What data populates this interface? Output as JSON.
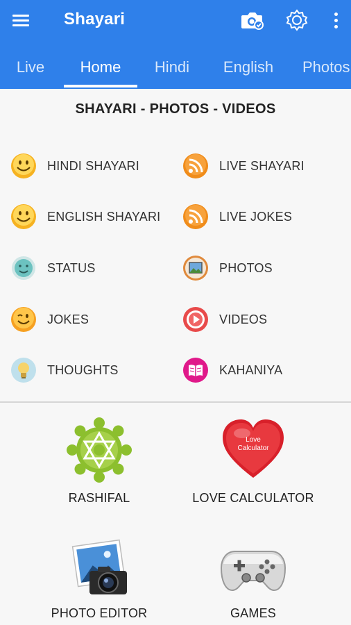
{
  "app": {
    "title": "Shayari"
  },
  "toolbar": {
    "menu_icon": "hamburger-menu-icon",
    "camera_icon": "camera-icon",
    "settings_icon": "gear-icon",
    "more_icon": "more-vert-icon"
  },
  "tabs": [
    {
      "label": "Live",
      "active": false
    },
    {
      "label": "Home",
      "active": true
    },
    {
      "label": "Hindi",
      "active": false
    },
    {
      "label": "English",
      "active": false
    },
    {
      "label": "Photos",
      "active": false
    }
  ],
  "section_title": "SHAYARI - PHOTOS - VIDEOS",
  "menu_items": [
    {
      "label": "HINDI SHAYARI",
      "icon": "smiley-icon"
    },
    {
      "label": "LIVE SHAYARI",
      "icon": "rss-icon"
    },
    {
      "label": "ENGLISH SHAYARI",
      "icon": "smiley-icon"
    },
    {
      "label": "LIVE JOKES",
      "icon": "rss-icon"
    },
    {
      "label": "STATUS",
      "icon": "status-face-icon"
    },
    {
      "label": "PHOTOS",
      "icon": "photo-icon"
    },
    {
      "label": "JOKES",
      "icon": "wink-icon"
    },
    {
      "label": "VIDEOS",
      "icon": "play-icon"
    },
    {
      "label": "THOUGHTS",
      "icon": "lightbulb-icon"
    },
    {
      "label": "KAHANIYA",
      "icon": "book-icon"
    }
  ],
  "tools": [
    {
      "label": "RASHIFAL",
      "icon": "zodiac-star-icon"
    },
    {
      "label": "LOVE CALCULATOR",
      "icon": "heart-icon",
      "icon_text": "Love Calculator"
    },
    {
      "label": "PHOTO EDITOR",
      "icon": "camera-photo-icon"
    },
    {
      "label": "GAMES",
      "icon": "gamepad-icon"
    }
  ],
  "colors": {
    "primary": "#2f80ea",
    "background": "#f7f7f7",
    "smiley": "#f6b221",
    "rss": "#f08c1a",
    "rashifal": "#8cbf2e",
    "heart": "#e0282f",
    "kahaniya": "#e0198a"
  }
}
